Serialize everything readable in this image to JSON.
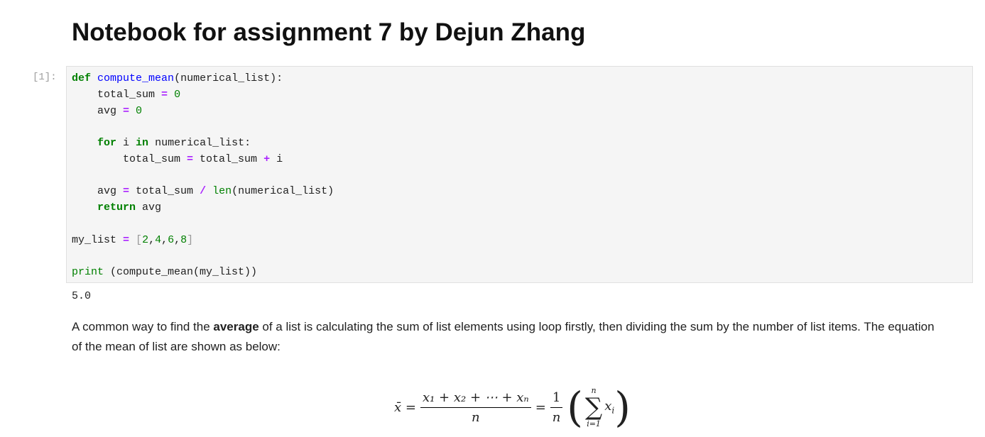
{
  "title": "Notebook for assignment 7 by Dejun Zhang",
  "cell": {
    "prompt": "[1]:",
    "lines": [
      [
        [
          "def",
          "kw"
        ],
        [
          " ",
          ""
        ],
        [
          "compute_mean",
          "fn"
        ],
        [
          "(numerical_list):",
          ""
        ]
      ],
      [
        [
          "    total_sum ",
          ""
        ],
        [
          "=",
          "op"
        ],
        [
          " ",
          ""
        ],
        [
          "0",
          "num"
        ]
      ],
      [
        [
          "    avg ",
          ""
        ],
        [
          "=",
          "op"
        ],
        [
          " ",
          ""
        ],
        [
          "0",
          "num"
        ]
      ],
      [],
      [
        [
          "    ",
          ""
        ],
        [
          "for",
          "kw"
        ],
        [
          " i ",
          ""
        ],
        [
          "in",
          "kw"
        ],
        [
          " numerical_list:",
          ""
        ]
      ],
      [
        [
          "        total_sum ",
          ""
        ],
        [
          "=",
          "op"
        ],
        [
          " total_sum ",
          ""
        ],
        [
          "+",
          "op"
        ],
        [
          " i",
          ""
        ]
      ],
      [],
      [
        [
          "    avg ",
          ""
        ],
        [
          "=",
          "op"
        ],
        [
          " total_sum ",
          ""
        ],
        [
          "/",
          "op"
        ],
        [
          " ",
          ""
        ],
        [
          "len",
          "bi"
        ],
        [
          "(numerical_list)",
          ""
        ]
      ],
      [
        [
          "    ",
          ""
        ],
        [
          "return",
          "kw"
        ],
        [
          " avg",
          ""
        ]
      ],
      [],
      [
        [
          "my_list ",
          ""
        ],
        [
          "=",
          "op"
        ],
        [
          " ",
          ""
        ],
        [
          "[",
          "br"
        ],
        [
          "2",
          "num"
        ],
        [
          ",",
          ""
        ],
        [
          "4",
          "num"
        ],
        [
          ",",
          ""
        ],
        [
          "6",
          "num"
        ],
        [
          ",",
          ""
        ],
        [
          "8",
          "num"
        ],
        [
          "]",
          "br"
        ]
      ],
      [],
      [
        [
          "print",
          "bi"
        ],
        [
          " (compute_mean(my_list))",
          ""
        ]
      ]
    ],
    "output": "5.0"
  },
  "markdown": {
    "before": "A common way to find the ",
    "bold": "average",
    "after": " of a list is calculating the sum of list elements using loop firstly, then dividing the sum by the number of list items. The equation of the mean of list are shown as below:"
  },
  "equation": {
    "lhs": "x̄ =",
    "numerator": "x₁ + x₂ + ⋯ + xₙ",
    "denominator": "n",
    "eq2": "=",
    "one": "1",
    "n": "n",
    "lparen": "(",
    "rparen": ")",
    "sum_top": "n",
    "sigma": "∑",
    "sum_bottom": "i=1",
    "term": "x",
    "term_sub": "i"
  }
}
